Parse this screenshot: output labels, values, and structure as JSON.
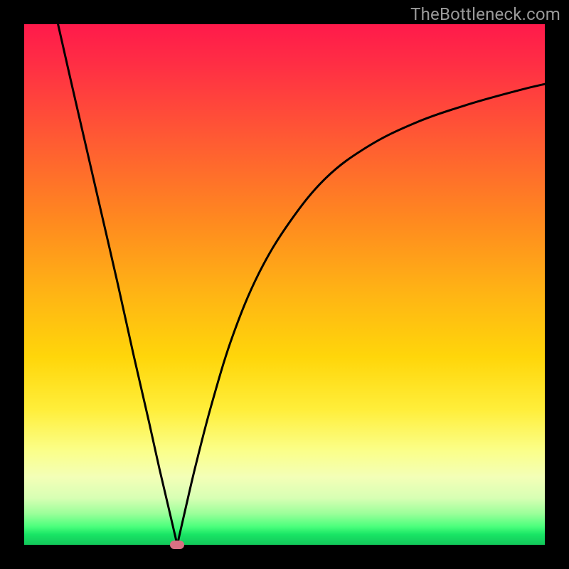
{
  "watermark": "TheBottleneck.com",
  "chart_data": {
    "type": "line",
    "title": "",
    "xlabel": "",
    "ylabel": "",
    "xlim": [
      0,
      100
    ],
    "ylim": [
      0,
      100
    ],
    "grid": false,
    "legend": false,
    "background_gradient": {
      "direction": "vertical",
      "stops": [
        {
          "pos": 0,
          "color": "#ff1a4b"
        },
        {
          "pos": 40,
          "color": "#ff8a1f"
        },
        {
          "pos": 70,
          "color": "#ffee3a"
        },
        {
          "pos": 90,
          "color": "#d8ffb4"
        },
        {
          "pos": 100,
          "color": "#12c75a"
        }
      ]
    },
    "series": [
      {
        "name": "left-branch",
        "x": [
          6.5,
          9,
          12,
          15,
          18,
          21,
          24,
          26,
          28,
          29.4
        ],
        "y": [
          100,
          89,
          76,
          63,
          50,
          36.5,
          23.5,
          14.5,
          6,
          0
        ]
      },
      {
        "name": "right-branch",
        "x": [
          29.4,
          31,
          33,
          36,
          40,
          45,
          51,
          58,
          66,
          75,
          85,
          95,
          100
        ],
        "y": [
          0,
          7,
          15.5,
          27,
          40,
          52,
          62,
          70.5,
          76.5,
          81,
          84.5,
          87.3,
          88.5
        ]
      }
    ],
    "marker": {
      "x": 29.4,
      "y": 0,
      "shape": "rounded-rect",
      "color": "#d97083"
    }
  },
  "colors": {
    "curve": "#000000",
    "frame": "#000000",
    "watermark": "#9a9a9a"
  }
}
